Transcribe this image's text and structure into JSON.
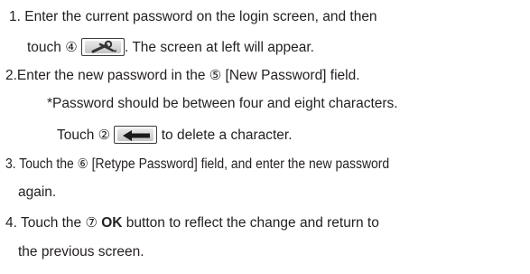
{
  "steps": [
    {
      "lines": [
        {
          "a": "1. Enter the current password on the login screen, and then"
        },
        {
          "a": "touch ",
          "num": "④",
          "b": ". The screen at left will appear.",
          "icon": "settings-wrench-icon"
        }
      ]
    },
    {
      "lines": [
        {
          "a": "2.Enter the new password in the ",
          "num": "⑤",
          "b": " [New Password] field."
        },
        {
          "a": "*Password should be between four and eight characters."
        },
        {
          "a": "Touch ",
          "num": "②",
          "b": " to delete a character.",
          "icon": "backspace-arrow-icon"
        }
      ]
    },
    {
      "lines": [
        {
          "a": "3. Touch the ",
          "num": "⑥",
          "b": " [Retype Password] field, and enter the new password"
        },
        {
          "a": "again."
        }
      ]
    },
    {
      "lines": [
        {
          "a": "4. Touch the ",
          "num": "⑦",
          "bold": " OK",
          "b": " button to reflect the change and return to"
        },
        {
          "a": "the previous screen."
        }
      ]
    }
  ],
  "colors": {
    "text": "#231f20",
    "icon_frame": "#3a3a3a",
    "icon_fill": "#d6d6d6"
  }
}
